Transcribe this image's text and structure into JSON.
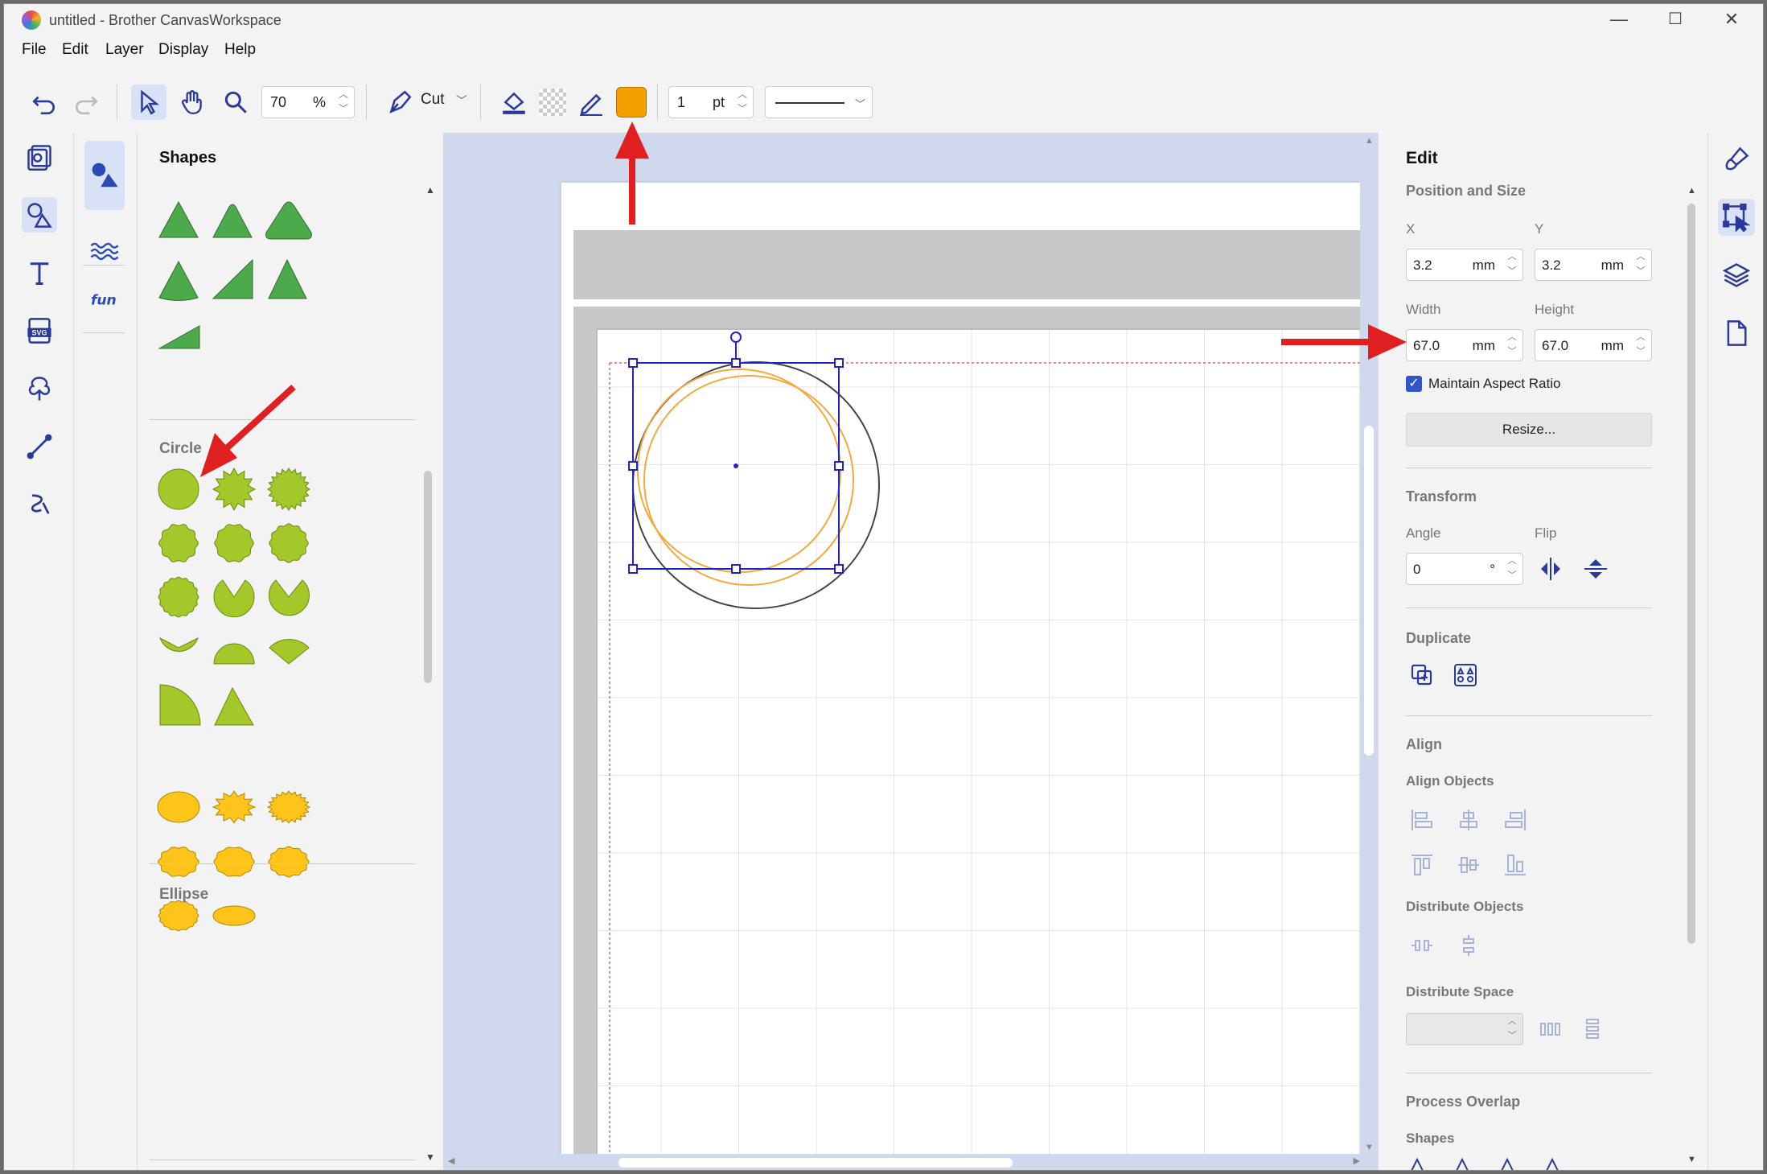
{
  "window": {
    "title": "untitled - Brother CanvasWorkspace",
    "controls": [
      "—",
      "☐",
      "✕"
    ]
  },
  "menu": [
    "File",
    "Edit",
    "Layer",
    "Display",
    "Help"
  ],
  "toolbar": {
    "zoom_value": "70",
    "zoom_unit": "%",
    "mode_label": "Cut",
    "line_width": "1",
    "line_unit": "pt",
    "fill_color": "#f5a000"
  },
  "shapes_panel": {
    "title": "Shapes",
    "sections": [
      {
        "name": "Circle",
        "color": "#a4c72a"
      },
      {
        "name": "Ellipse",
        "color": "#ffc41a"
      }
    ],
    "triangle_color": "#4caa4c"
  },
  "edit_panel": {
    "title": "Edit",
    "position_size": {
      "heading": "Position and Size",
      "x_label": "X",
      "x_value": "3.2",
      "y_label": "Y",
      "y_value": "3.2",
      "unit": "mm",
      "width_label": "Width",
      "width_value": "67.0",
      "height_label": "Height",
      "height_value": "67.0",
      "aspect_label": "Maintain Aspect Ratio",
      "aspect_checked": true,
      "resize_label": "Resize..."
    },
    "transform": {
      "heading": "Transform",
      "angle_label": "Angle",
      "angle_value": "0",
      "angle_unit": "°",
      "flip_label": "Flip"
    },
    "duplicate": {
      "heading": "Duplicate"
    },
    "align": {
      "heading": "Align",
      "align_objects": "Align Objects",
      "distribute_objects": "Distribute Objects",
      "distribute_space": "Distribute Space"
    },
    "process": {
      "heading": "Process Overlap",
      "shapes_label": "Shapes"
    }
  },
  "annotation_color": "#e02020"
}
